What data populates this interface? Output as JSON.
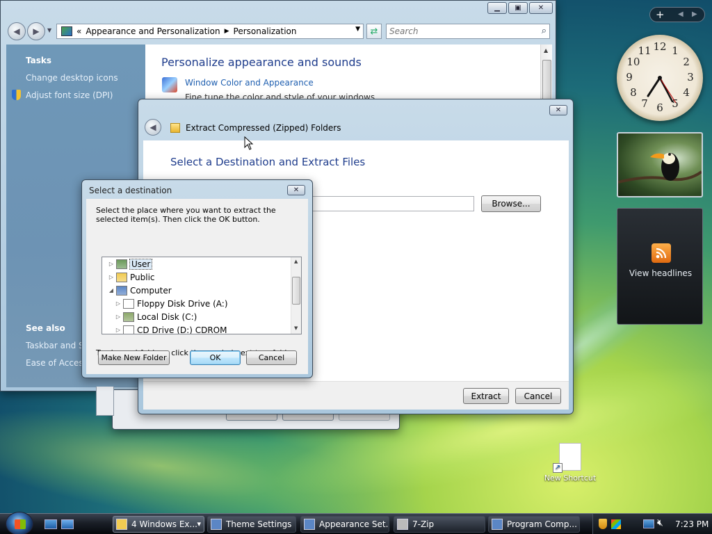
{
  "personalization": {
    "breadcrumb_prefix": "«",
    "breadcrumb": [
      "Appearance and Personalization",
      "Personalization"
    ],
    "search_placeholder": "Search",
    "tasks_header": "Tasks",
    "tasks": [
      "Change desktop icons",
      "Adjust font size (DPI)"
    ],
    "see_also_header": "See also",
    "see_also": [
      "Taskbar and Sta",
      "Ease of Access"
    ],
    "heading": "Personalize appearance and sounds",
    "item_title": "Window Color and Appearance",
    "item_desc": "Fine tune the color and style of your windows"
  },
  "extract_window": {
    "title": "Extract Compressed (Zipped) Folders",
    "heading": "Select a Destination and Extract Files",
    "browse_label": "Browse...",
    "extract_label": "Extract",
    "cancel_label": "Cancel"
  },
  "dest_dialog": {
    "title": "Select a destination",
    "instructions": "Select the place where you want to extract the selected item(s).  Then click the OK button.",
    "tree": [
      {
        "label": "User",
        "indent": 0,
        "expander": "▷",
        "selected": true
      },
      {
        "label": "Public",
        "indent": 0,
        "expander": "▷",
        "selected": false
      },
      {
        "label": "Computer",
        "indent": 0,
        "expander": "◢",
        "selected": false
      },
      {
        "label": "Floppy Disk Drive (A:)",
        "indent": 1,
        "expander": "▷",
        "selected": false
      },
      {
        "label": "Local Disk (C:)",
        "indent": 1,
        "expander": "▷",
        "selected": false
      },
      {
        "label": "CD Drive (D:) CDROM",
        "indent": 1,
        "expander": "▷",
        "selected": false
      }
    ],
    "hint": "To view subfolders, click the symbol next to a folder.",
    "new_folder_label": "Make New Folder",
    "ok_label": "OK",
    "cancel_label": "Cancel"
  },
  "gadgets": {
    "sidebar_add": "+",
    "clock_numbers": [
      "12",
      "1",
      "2",
      "3",
      "4",
      "5",
      "6",
      "7",
      "8",
      "9",
      "10",
      "11"
    ],
    "rss_label": "View headlines"
  },
  "desktop": {
    "shortcut_label": "New Shortcut"
  },
  "taskbar": {
    "items": [
      {
        "label": "4 Windows Ex...",
        "active": true
      },
      {
        "label": "Theme Settings",
        "active": false
      },
      {
        "label": "Appearance Set...",
        "active": false
      },
      {
        "label": "7-Zip",
        "active": false
      },
      {
        "label": "Program Comp...",
        "active": false
      }
    ],
    "time": "7:23 PM"
  },
  "colors": {
    "link": "#1f5fb0",
    "heading": "#1e3c8c",
    "accent": "#3c7fb1"
  }
}
